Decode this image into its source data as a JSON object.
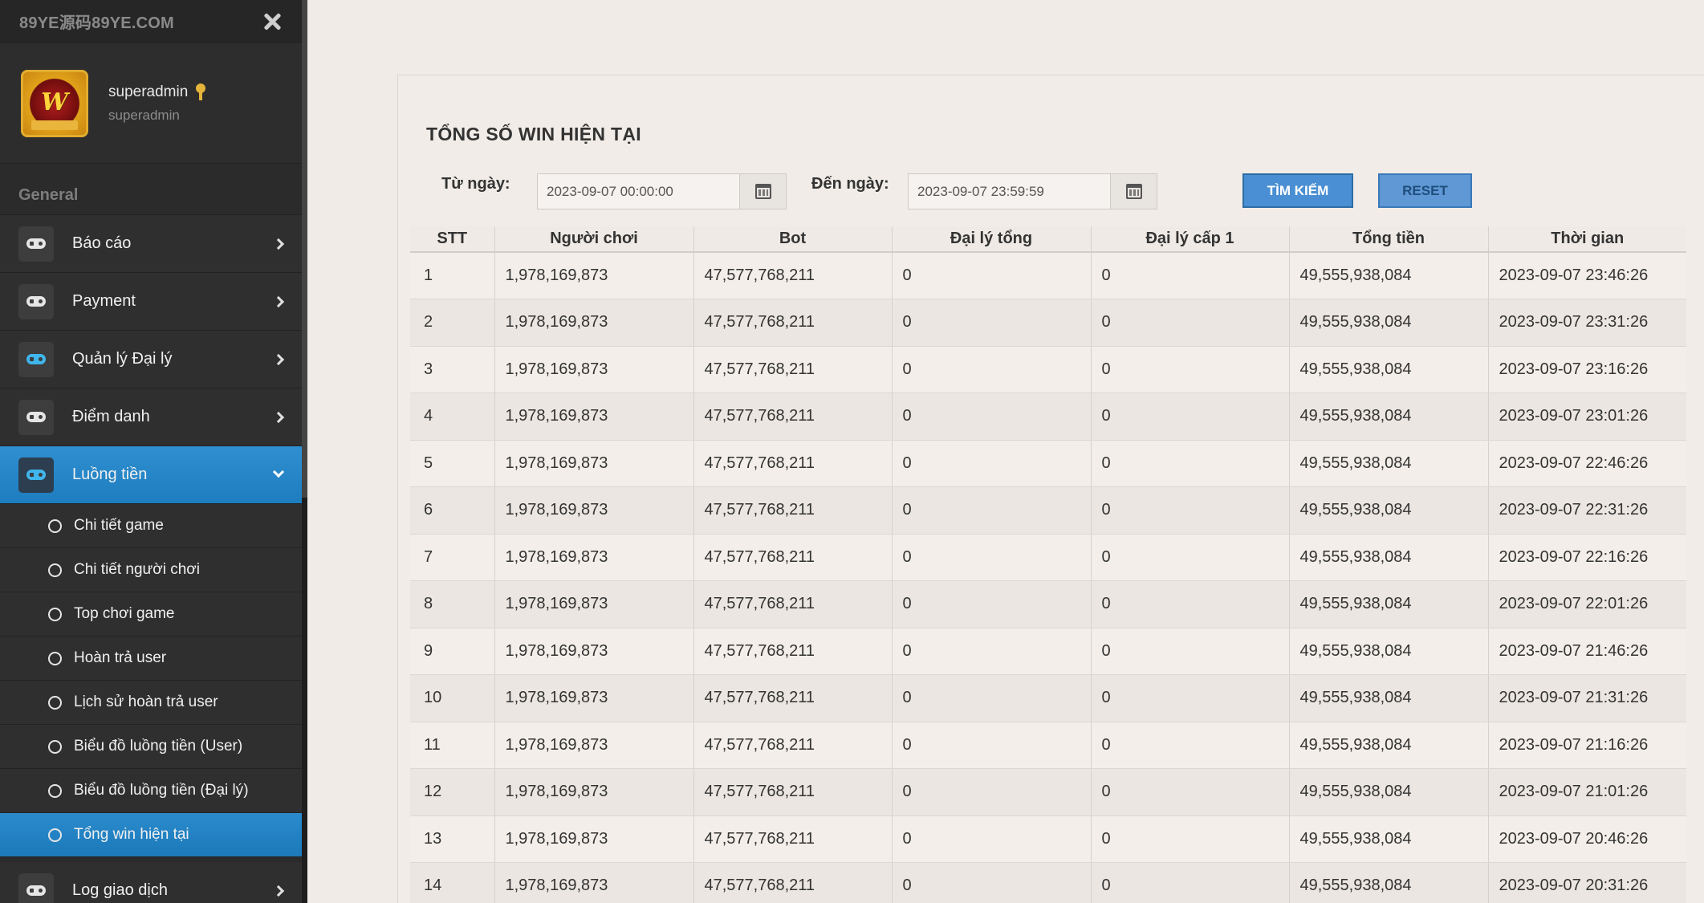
{
  "sidebar": {
    "brand": "89YE源码89YE.COM",
    "profile": {
      "name": "superadmin",
      "role": "superadmin"
    },
    "section": "General",
    "menu": [
      {
        "label": "Báo cáo"
      },
      {
        "label": "Payment"
      },
      {
        "label": "Quản lý Đại lý"
      },
      {
        "label": "Điểm danh"
      },
      {
        "label": "Luồng tiền"
      }
    ],
    "submenu": [
      {
        "label": "Chi tiết game"
      },
      {
        "label": "Chi tiết người chơi"
      },
      {
        "label": "Top chơi game"
      },
      {
        "label": "Hoàn trả user"
      },
      {
        "label": "Lịch sử hoàn trả user"
      },
      {
        "label": "Biểu đồ luồng tiền (User)"
      },
      {
        "label": "Biểu đồ luồng tiền (Đại lý)"
      },
      {
        "label": "Tổng win hiện tại"
      }
    ],
    "last_menu": {
      "label": "Log giao dịch"
    }
  },
  "main": {
    "title": "TỔNG SỐ WIN HIỆN TẠI",
    "from_label": "Từ ngày:",
    "from_value": "2023-09-07 00:00:00",
    "to_label": "Đến ngày:",
    "to_value": "2023-09-07 23:59:59",
    "search_label": "TÌM KIẾM",
    "reset_label": "RESET"
  },
  "table": {
    "headers": [
      "STT",
      "Người chơi",
      "Bot",
      "Đại lý tổng",
      "Đại lý cấp 1",
      "Tổng tiền",
      "Thời gian"
    ],
    "rows": [
      [
        "1",
        "1,978,169,873",
        "47,577,768,211",
        "0",
        "0",
        "49,555,938,084",
        "2023-09-07 23:46:26"
      ],
      [
        "2",
        "1,978,169,873",
        "47,577,768,211",
        "0",
        "0",
        "49,555,938,084",
        "2023-09-07 23:31:26"
      ],
      [
        "3",
        "1,978,169,873",
        "47,577,768,211",
        "0",
        "0",
        "49,555,938,084",
        "2023-09-07 23:16:26"
      ],
      [
        "4",
        "1,978,169,873",
        "47,577,768,211",
        "0",
        "0",
        "49,555,938,084",
        "2023-09-07 23:01:26"
      ],
      [
        "5",
        "1,978,169,873",
        "47,577,768,211",
        "0",
        "0",
        "49,555,938,084",
        "2023-09-07 22:46:26"
      ],
      [
        "6",
        "1,978,169,873",
        "47,577,768,211",
        "0",
        "0",
        "49,555,938,084",
        "2023-09-07 22:31:26"
      ],
      [
        "7",
        "1,978,169,873",
        "47,577,768,211",
        "0",
        "0",
        "49,555,938,084",
        "2023-09-07 22:16:26"
      ],
      [
        "8",
        "1,978,169,873",
        "47,577,768,211",
        "0",
        "0",
        "49,555,938,084",
        "2023-09-07 22:01:26"
      ],
      [
        "9",
        "1,978,169,873",
        "47,577,768,211",
        "0",
        "0",
        "49,555,938,084",
        "2023-09-07 21:46:26"
      ],
      [
        "10",
        "1,978,169,873",
        "47,577,768,211",
        "0",
        "0",
        "49,555,938,084",
        "2023-09-07 21:31:26"
      ],
      [
        "11",
        "1,978,169,873",
        "47,577,768,211",
        "0",
        "0",
        "49,555,938,084",
        "2023-09-07 21:16:26"
      ],
      [
        "12",
        "1,978,169,873",
        "47,577,768,211",
        "0",
        "0",
        "49,555,938,084",
        "2023-09-07 21:01:26"
      ],
      [
        "13",
        "1,978,169,873",
        "47,577,768,211",
        "0",
        "0",
        "49,555,938,084",
        "2023-09-07 20:46:26"
      ],
      [
        "14",
        "1,978,169,873",
        "47,577,768,211",
        "0",
        "0",
        "49,555,938,084",
        "2023-09-07 20:31:26"
      ]
    ]
  }
}
